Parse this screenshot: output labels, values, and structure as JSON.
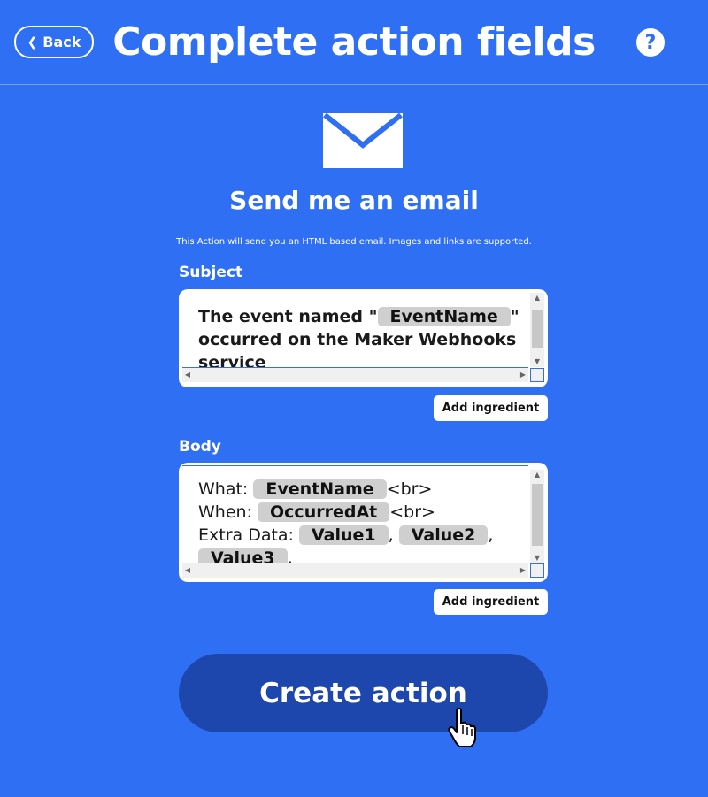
{
  "header": {
    "back_label": "Back",
    "title": "Complete action fields",
    "help_symbol": "?"
  },
  "action": {
    "icon": "mail-icon",
    "title": "Send me an email",
    "description": "This Action will send you an HTML based email. Images and links are supported."
  },
  "subject": {
    "label": "Subject",
    "text_before": "The event named \"",
    "chip": "EventName",
    "text_after": "\" occurred on the Maker Webhooks service",
    "add_ingredient_label": "Add ingredient"
  },
  "body": {
    "label": "Body",
    "line1_prefix": "What: ",
    "line1_chip": "EventName",
    "line1_suffix": "<br>",
    "line2_prefix": "When: ",
    "line2_chip": "OccurredAt",
    "line2_suffix": "<br>",
    "line3_prefix": "Extra Data: ",
    "line3_chip1": "Value1",
    "line3_sep1": ",",
    "line3_chip2": "Value2",
    "line3_sep2": ",",
    "line4_chip": "Value3",
    "line4_suffix": ",",
    "add_ingredient_label": "Add ingredient"
  },
  "create_button_label": "Create action",
  "colors": {
    "background": "#2f6ff3",
    "create_button": "#1d47ad",
    "chip": "#cfcfcf"
  }
}
